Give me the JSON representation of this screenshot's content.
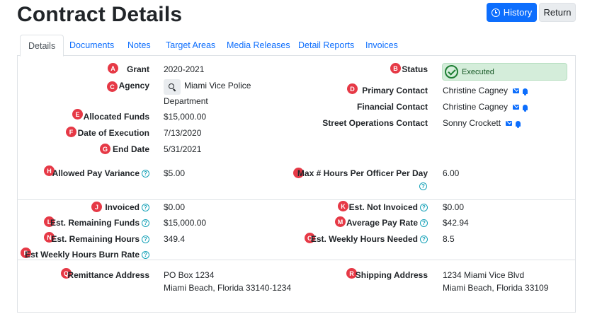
{
  "header": {
    "title": "Contract Details",
    "history_label": "History",
    "return_label": "Return"
  },
  "tabs": [
    {
      "label": "Details",
      "active": true
    },
    {
      "label": "Documents"
    },
    {
      "label": "Notes"
    },
    {
      "label": "Target Areas"
    },
    {
      "label": "Media Releases"
    },
    {
      "label": "Detail Reports"
    },
    {
      "label": "Invoices"
    }
  ],
  "fields": {
    "grant": {
      "badge": "A",
      "label": "Grant",
      "value": "2020-2021"
    },
    "status": {
      "badge": "B",
      "label": "Status",
      "value": "Executed"
    },
    "agency": {
      "badge": "C",
      "label": "Agency",
      "value_line1": "Miami Vice Police",
      "value_line2": "Department"
    },
    "primary_contact": {
      "badge": "D",
      "label": "Primary Contact",
      "value": "Christine Cagney"
    },
    "financial_contact": {
      "label": "Financial Contact",
      "value": "Christine Cagney"
    },
    "street_contact": {
      "label": "Street Operations Contact",
      "value": "Sonny Crockett"
    },
    "allocated_funds": {
      "badge": "E",
      "label": "Allocated Funds",
      "value": "$15,000.00"
    },
    "date_of_execution": {
      "badge": "F",
      "label": "Date of Execution",
      "value": "7/13/2020"
    },
    "end_date": {
      "badge": "G",
      "label": "End Date",
      "value": "5/31/2021"
    },
    "allowed_pay_variance": {
      "badge": "H",
      "label": "Allowed Pay Variance",
      "value": "$5.00"
    },
    "max_hours": {
      "badge": "I",
      "label": "Max # Hours Per Officer Per Day",
      "value": "6.00"
    },
    "invoiced": {
      "badge": "J",
      "label": "Invoiced",
      "value": "$0.00"
    },
    "est_not_invoiced": {
      "badge": "K",
      "label": "Est. Not Invoiced",
      "value": "$0.00"
    },
    "est_remaining_funds": {
      "badge": "L",
      "label": "Est. Remaining Funds",
      "value": "$15,000.00"
    },
    "average_pay_rate": {
      "badge": "M",
      "label": "Average Pay Rate",
      "value": "$42.94"
    },
    "est_remaining_hours": {
      "badge": "N",
      "label": "Est. Remaining Hours",
      "value": "349.4"
    },
    "est_weekly_hours_needed": {
      "badge": "O",
      "label": "Est. Weekly Hours Needed",
      "value": "8.5"
    },
    "est_weekly_burn_rate": {
      "badge": "P",
      "label": "Est Weekly Hours Burn Rate"
    },
    "remittance_address": {
      "badge": "Q",
      "label": "Remittance Address",
      "value_line1": "PO Box 1234",
      "value_line2": "Miami Beach, Florida 33140-1234"
    },
    "shipping_address": {
      "badge": "R",
      "label": "Shipping Address",
      "value_line1": "1234 Miami Vice Blvd",
      "value_line2": "Miami Beach, Florida 33109"
    }
  },
  "icons": {
    "help_glyph": "?"
  },
  "colors": {
    "accent": "#0d6efd",
    "badge": "#e63946",
    "status_bg": "#d4edda",
    "help": "#17a2b8"
  }
}
